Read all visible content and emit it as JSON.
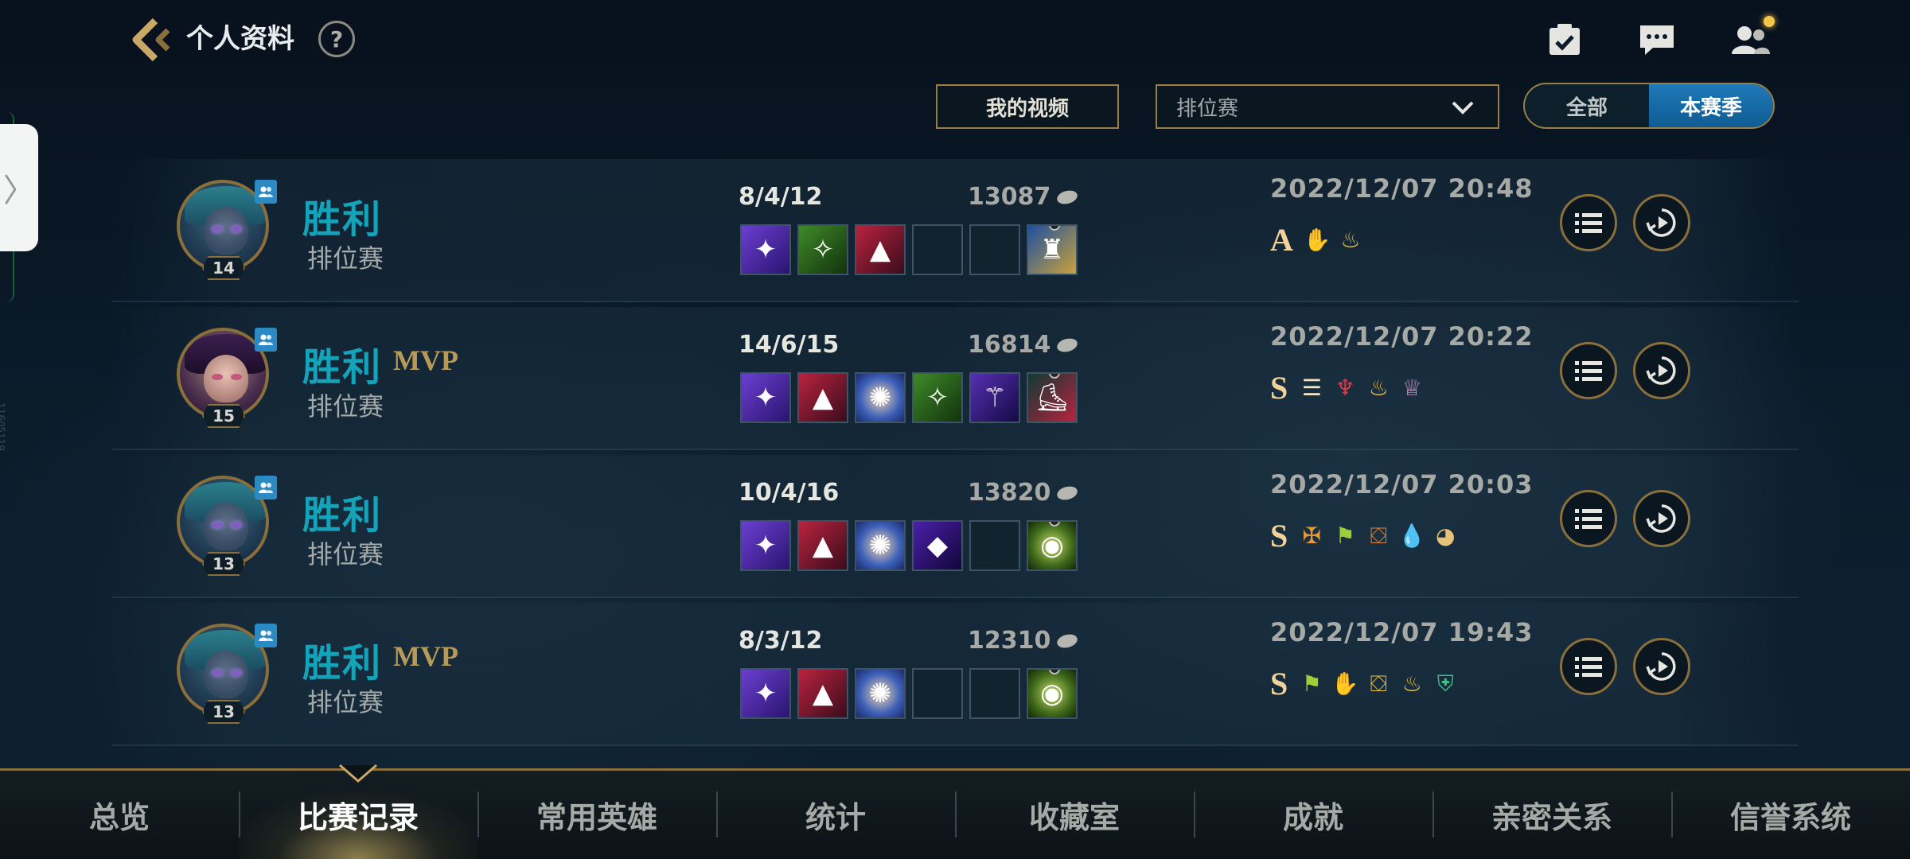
{
  "header": {
    "title": "个人资料",
    "help_label": "?"
  },
  "filters": {
    "my_video_label": "我的视频",
    "mode_selected": "排位赛",
    "season_options": [
      "全部",
      "本赛季"
    ],
    "season_active": "本赛季"
  },
  "side": {
    "handle_glyph": "〉",
    "tiny_text": "11605119"
  },
  "matches": [
    {
      "result": "胜利",
      "mvp": "",
      "mode": "排位赛",
      "level": "14",
      "kda": "8/4/12",
      "gold": "13087",
      "datetime": "2022/12/07 20:48",
      "grade": "A",
      "items": [
        "staff-blue",
        "claw-green",
        "hat-red",
        "",
        "",
        "trinket-yellow"
      ]
    },
    {
      "result": "胜利",
      "mvp": "MVP",
      "mode": "排位赛",
      "level": "15",
      "kda": "14/6/15",
      "gold": "16814",
      "datetime": "2022/12/07 20:22",
      "grade": "S",
      "items": [
        "staff-blue",
        "hat-red",
        "orb-blue",
        "claw-green",
        "rod-purple",
        "boots-red"
      ]
    },
    {
      "result": "胜利",
      "mvp": "",
      "mode": "排位赛",
      "level": "13",
      "kda": "10/4/16",
      "gold": "13820",
      "datetime": "2022/12/07 20:03",
      "grade": "S",
      "items": [
        "staff-blue",
        "hat-red",
        "orb-blue",
        "rune-purple",
        "",
        "trinket-green"
      ]
    },
    {
      "result": "胜利",
      "mvp": "MVP",
      "mode": "排位赛",
      "level": "13",
      "kda": "8/3/12",
      "gold": "12310",
      "datetime": "2022/12/07 19:43",
      "grade": "S",
      "items": [
        "staff-blue",
        "hat-red",
        "orb-blue",
        "",
        "",
        "trinket-green"
      ]
    }
  ],
  "bottom_nav": {
    "tabs": [
      "总览",
      "比赛记录",
      "常用英雄",
      "统计",
      "收藏室",
      "成就",
      "亲密关系",
      "信誉系统"
    ],
    "active": "比赛记录"
  },
  "colors": {
    "accent_gold": "#8a6f3a",
    "win_text": "#14a3b8",
    "toggle_active": "#1f79b8"
  }
}
